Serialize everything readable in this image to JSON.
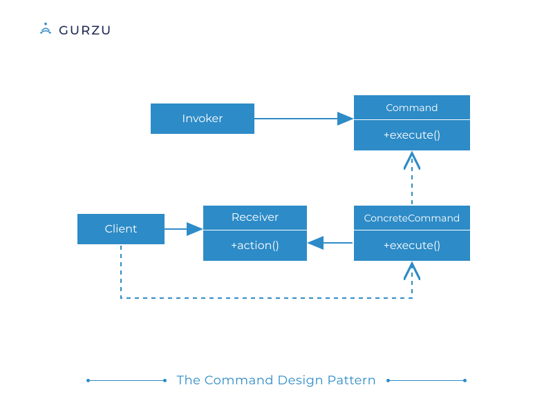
{
  "brand": {
    "name": "GURZU"
  },
  "caption": "The Command Design Pattern",
  "colors": {
    "primary": "#2d8bc7",
    "brandNavy": "#1e2a57"
  },
  "nodes": {
    "invoker": {
      "label": "Invoker"
    },
    "command": {
      "label": "Command",
      "method": "+execute()"
    },
    "client": {
      "label": "Client"
    },
    "receiver": {
      "label": "Receiver",
      "method": "+action()"
    },
    "concrete": {
      "label": "ConcreteCommand",
      "method": "+execute()"
    }
  },
  "edges": [
    {
      "from": "invoker",
      "to": "command",
      "style": "solid",
      "kind": "association"
    },
    {
      "from": "concrete",
      "to": "command",
      "style": "dashed",
      "kind": "realization"
    },
    {
      "from": "client",
      "to": "receiver",
      "style": "solid",
      "kind": "association"
    },
    {
      "from": "concrete",
      "to": "receiver",
      "style": "solid",
      "kind": "association"
    },
    {
      "from": "client",
      "to": "concrete",
      "style": "dashed",
      "kind": "dependency"
    }
  ]
}
